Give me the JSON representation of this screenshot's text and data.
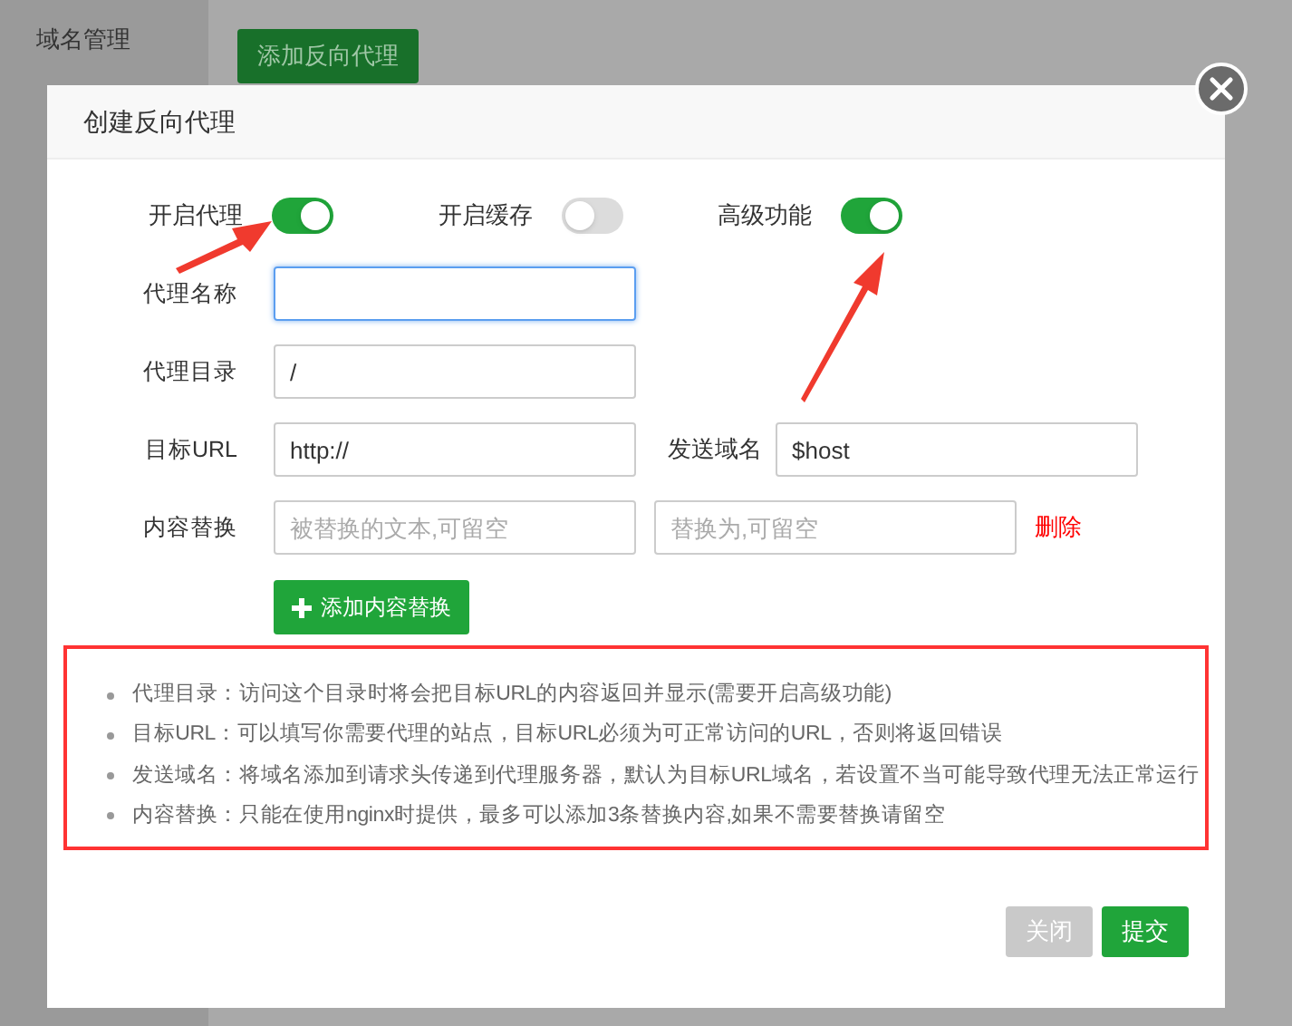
{
  "sidebar": {
    "items": [
      {
        "label": "域名管理"
      }
    ]
  },
  "toolbar": {
    "button": "添加反向代理"
  },
  "dialog": {
    "title": "创建反向代理",
    "toggles": [
      {
        "label": "开启代理",
        "on": true
      },
      {
        "label": "开启缓存",
        "on": false
      },
      {
        "label": "高级功能",
        "on": true
      }
    ],
    "rows": [
      {
        "label": "代理名称",
        "fields": [
          {
            "focused": true
          }
        ]
      },
      {
        "label": "代理目录",
        "fields": [
          {
            "value": "/",
            "focused": false
          }
        ]
      },
      {
        "label": "目标URL",
        "fields": [
          {
            "value": "http://",
            "focused": false
          },
          {
            "label": "发送域名",
            "value": "$host",
            "focused": false
          }
        ]
      },
      {
        "label": "内容替换",
        "fields": [
          {
            "placeholder": "被替换的文本,可留空",
            "focused": false
          },
          {
            "placeholder": "替换为,可留空",
            "focused": false
          }
        ],
        "delete": "删除"
      }
    ],
    "add_button": "添加内容替换",
    "notes": [
      "代理目录：访问这个目录时将会把目标URL的内容返回并显示(需要开启高级功能)",
      "目标URL：可以填写你需要代理的站点，目标URL必须为可正常访问的URL，否则将返回错误",
      "发送域名：将域名添加到请求头传递到代理服务器，默认为目标URL域名，若设置不当可能导致代理无法正常运行",
      "内容替换：只能在使用nginx时提供，最多可以添加3条替换内容,如果不需要替换请留空"
    ],
    "buttons": [
      {
        "label": "关闭",
        "kind": "secondary"
      },
      {
        "label": "提交",
        "kind": "primary"
      }
    ]
  }
}
